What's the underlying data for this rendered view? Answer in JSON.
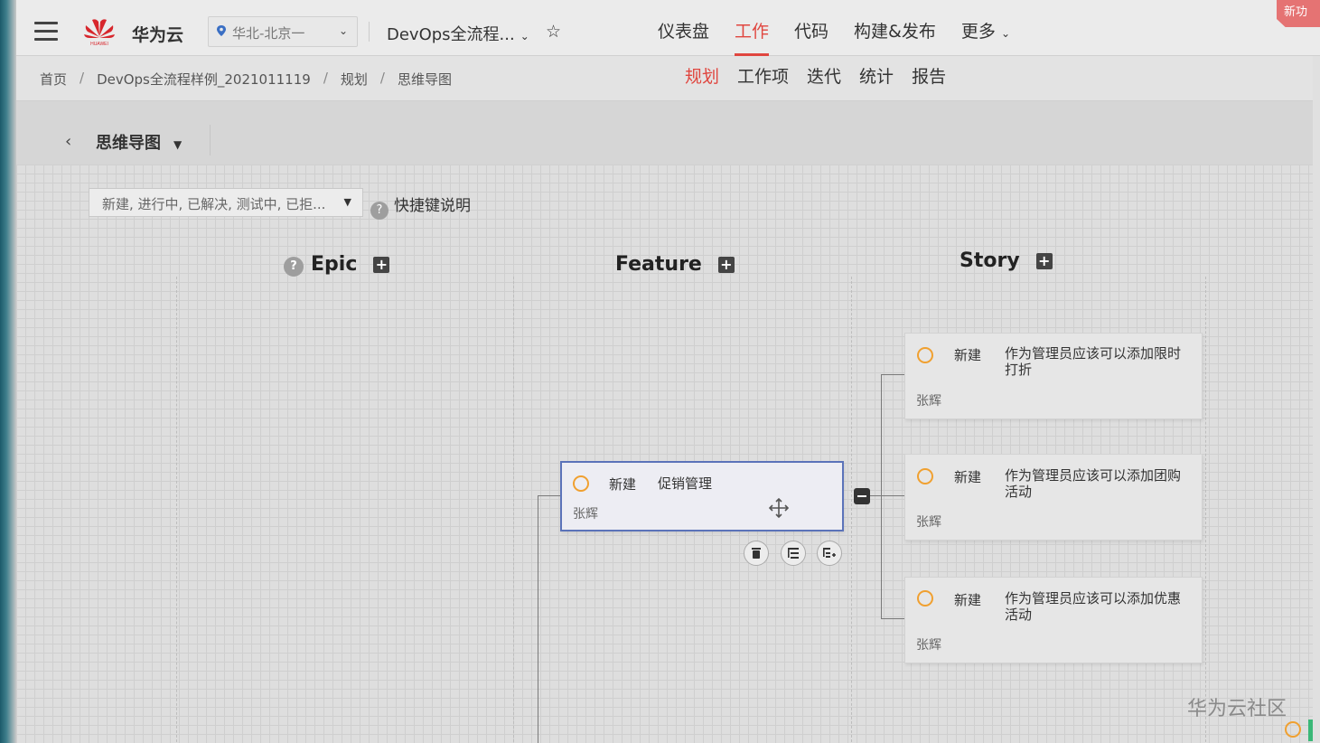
{
  "topbar": {
    "logo_caption": "HUAWEI",
    "brand": "华为云",
    "region": "华北-北京一",
    "project": "DevOps全流程...",
    "nav": [
      {
        "label": "仪表盘",
        "active": false
      },
      {
        "label": "工作",
        "active": true
      },
      {
        "label": "代码",
        "active": false
      },
      {
        "label": "构建&发布",
        "active": false
      },
      {
        "label": "更多",
        "active": false
      }
    ],
    "corner_badge": "新功",
    "accent_color": "#e0463f"
  },
  "breadcrumb": {
    "items": [
      "首页",
      "DevOps全流程样例_2021011119",
      "规划",
      "思维导图"
    ],
    "separator": "/"
  },
  "subnav": [
    {
      "label": "规划",
      "active": true
    },
    {
      "label": "工作项",
      "active": false
    },
    {
      "label": "迭代",
      "active": false
    },
    {
      "label": "统计",
      "active": false
    },
    {
      "label": "报告",
      "active": false
    }
  ],
  "view": {
    "title": "思维导图"
  },
  "toolbar": {
    "filter_value": "新建, 进行中, 已解决, 测试中, 已拒...",
    "shortcut_label": "快捷键说明"
  },
  "columns": {
    "epic": "Epic",
    "feature": "Feature",
    "story": "Story"
  },
  "feature_card": {
    "status": "新建",
    "title": "促销管理",
    "owner": "张辉"
  },
  "stories": [
    {
      "status": "新建",
      "title": "作为管理员应该可以添加限时打折",
      "owner": "张辉"
    },
    {
      "status": "新建",
      "title": "作为管理员应该可以添加团购活动",
      "owner": "张辉"
    },
    {
      "status": "新建",
      "title": "作为管理员应该可以添加优惠活动",
      "owner": "张辉"
    }
  ],
  "watermark": "华为云社区",
  "colors": {
    "status_new": "#f0a030",
    "selected_border": "#5b73b9"
  }
}
